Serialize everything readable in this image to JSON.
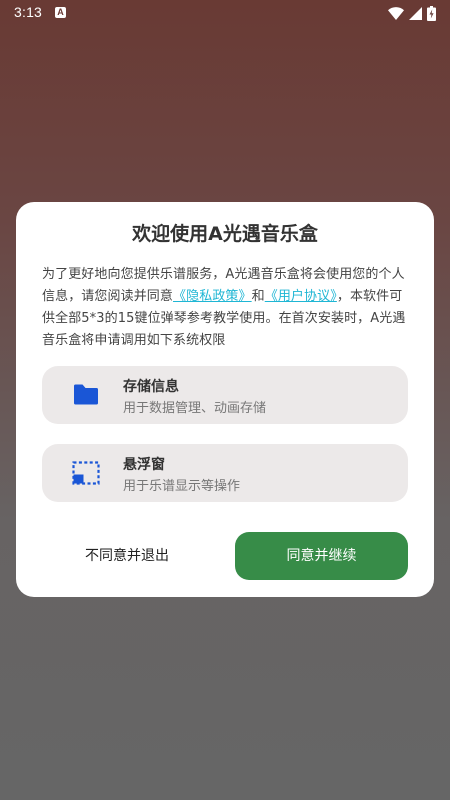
{
  "status_bar": {
    "time": "3:13",
    "notification_glyph": "A",
    "icons": [
      "wifi-icon",
      "signal-icon",
      "battery-charging-icon"
    ]
  },
  "dialog": {
    "title": "欢迎使用A光遇音乐盒",
    "body": {
      "part1": "为了更好地向您提供乐谱服务，A光遇音乐盒将会使用您的个人信息，请您阅读并同意",
      "privacy_link": "《隐私政策》",
      "and_text": "和",
      "user_agreement_link": "《用户协议》",
      "part2": "，本软件可供全部5*3的15键位弹琴参考教学使用。在首次安装时，A光遇音乐盒将申请调用如下系统权限"
    },
    "permissions": [
      {
        "icon": "folder-icon",
        "title": "存储信息",
        "description": "用于数据管理、动画存储"
      },
      {
        "icon": "floating-window-icon",
        "title": "悬浮窗",
        "description": "用于乐谱显示等操作"
      }
    ],
    "decline_label": "不同意并退出",
    "agree_label": "同意并继续"
  },
  "colors": {
    "background_top": "#693a34",
    "background_bottom": "#666666",
    "link": "#1fb6d4",
    "agree_button": "#378c48",
    "permission_card": "#ece9e9",
    "icon_blue": "#1a56d6"
  }
}
